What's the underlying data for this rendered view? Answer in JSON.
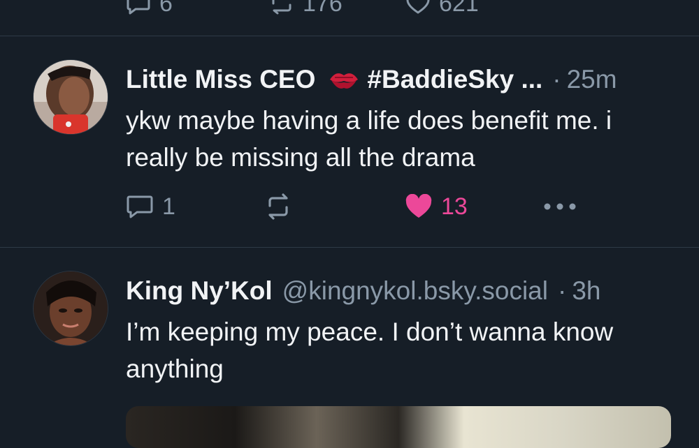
{
  "top_post": {
    "reply_count": "6",
    "repost_count": "176",
    "like_count": "621"
  },
  "posts": [
    {
      "display_name": "Little Miss CEO",
      "handle": "#BaddieSky ...",
      "time": "25m",
      "text": "ykw maybe having a life does benefit me. i really be missing all the drama",
      "replies": "1",
      "reposts": "",
      "likes": "13",
      "liked": true,
      "emoji_icon": "kiss-mark-icon"
    },
    {
      "display_name": "King Ny’Kol",
      "handle": "@kingnykol.bsky.social",
      "time": "3h",
      "text": "I’m keeping my peace. I don’t wanna know anything"
    }
  ],
  "colors": {
    "background": "#161e27",
    "text": "#f1f3f5",
    "muted": "#8a99a8",
    "like": "#ec4899",
    "divider": "#2e3a47"
  }
}
